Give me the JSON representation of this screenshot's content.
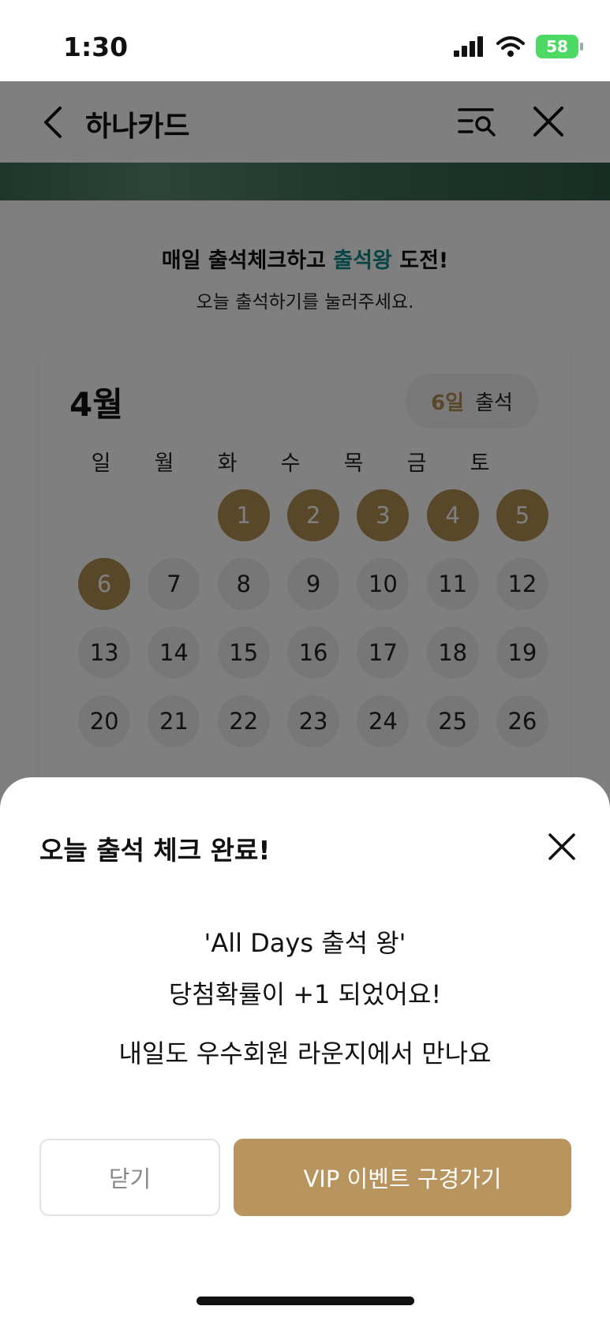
{
  "status_bar": {
    "time": "1:30",
    "battery": "58"
  },
  "header": {
    "title": "하나카드"
  },
  "promo": {
    "headline_prefix": "매일 출석체크하고 ",
    "headline_accent": "출석왕",
    "headline_suffix": " 도전!",
    "subtext": "오늘 출석하기를 눌러주세요."
  },
  "calendar": {
    "month": "4월",
    "attended_count": "6일",
    "attended_label": "출석",
    "weekdays": [
      "일",
      "월",
      "화",
      "수",
      "목",
      "금",
      "토"
    ],
    "days": [
      "1",
      "2",
      "3",
      "4",
      "5",
      "6",
      "7",
      "8",
      "9",
      "10",
      "11",
      "12",
      "13",
      "14",
      "15",
      "16",
      "17",
      "18",
      "19",
      "20",
      "21",
      "22",
      "23",
      "24",
      "25",
      "26"
    ],
    "checked_days": [
      "1",
      "2",
      "3",
      "4",
      "5",
      "6"
    ]
  },
  "sheet": {
    "title": "오늘 출석 체크 완료!",
    "line1": "'All Days 출석 왕'",
    "line2": "당첨확률이 +1 되었어요!",
    "line3": "내일도 우수회원 라운지에서 만나요",
    "close_button": "닫기",
    "vip_button": "VIP 이벤트 구경가기"
  },
  "colors": {
    "accent_gold": "#b8955f",
    "accent_teal": "#138a8a",
    "battery_green": "#4cd964"
  }
}
